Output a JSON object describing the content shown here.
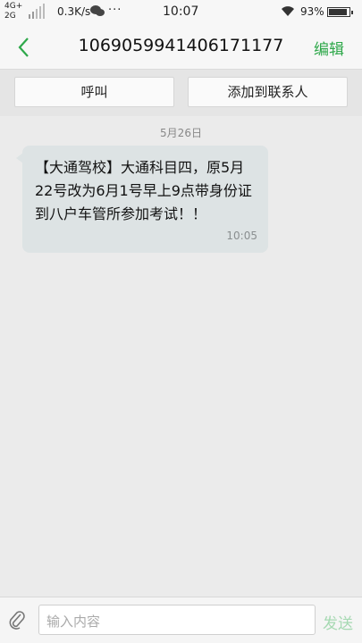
{
  "status_bar": {
    "network_top": "4G+",
    "network_bottom": "2G",
    "speed": "0.3K/s",
    "chat_icon": "wechat-icon",
    "more": "···",
    "time": "10:07",
    "wifi_icon": "wifi-icon",
    "battery_percent": "93%",
    "battery_level": 0.93
  },
  "header": {
    "back_icon": "chevron-left-icon",
    "title": "1069059941406171177",
    "edit_label": "编辑",
    "accent": "#2ea84a"
  },
  "actions": {
    "call_label": "呼叫",
    "add_contact_label": "添加到联系人"
  },
  "thread": {
    "date": "5月26日",
    "messages": [
      {
        "text": "【大通驾校】大通科目四，原5月22号改为6月1号早上9点带身份证到八户车管所参加考试！！",
        "time": "10:05"
      }
    ]
  },
  "composer": {
    "attach_icon": "paperclip-icon",
    "placeholder": "输入内容",
    "send_label": "发送"
  }
}
